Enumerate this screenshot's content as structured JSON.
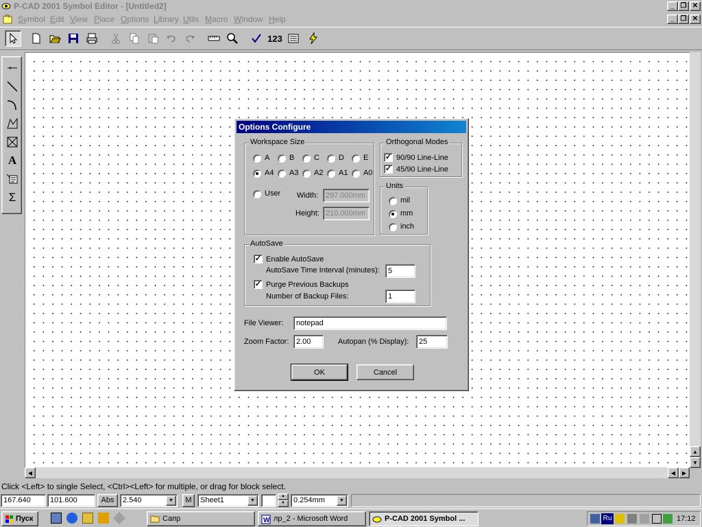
{
  "window": {
    "title": "P-CAD 2001 Symbol Editor - [Untitled2]",
    "controls": [
      "_",
      "❐",
      "✕"
    ]
  },
  "menu": [
    "Symbol",
    "Edit",
    "View",
    "Place",
    "Options",
    "Library",
    "Utils",
    "Macro",
    "Window",
    "Help"
  ],
  "toolbar": {
    "label_123": "123",
    "icons": [
      "select-arrow",
      "new-file",
      "open-folder",
      "save-disk",
      "print",
      "cut",
      "copy",
      "paste",
      "undo",
      "redo",
      "measure",
      "zoom",
      "check",
      "renumber",
      "properties",
      "lightning"
    ]
  },
  "left_tools": [
    "place-pin",
    "place-line",
    "place-arc",
    "place-polygon",
    "place-point",
    "place-text",
    "place-attribute",
    "place-field"
  ],
  "dialog": {
    "title": "Options Configure",
    "workspace_size": {
      "label": "Workspace Size",
      "row1": [
        "A",
        "B",
        "C",
        "D",
        "E"
      ],
      "row2": [
        "A4",
        "A3",
        "A2",
        "A1",
        "A0"
      ],
      "selected": "A4",
      "user_label": "User",
      "width_label": "Width:",
      "width_value": "297.000mm",
      "height_label": "Height:",
      "height_value": "210.000mm"
    },
    "orthogonal_modes": {
      "label": "Orthogonal Modes",
      "opt1": "90/90  Line-Line",
      "opt2": "45/90  Line-Line"
    },
    "units": {
      "label": "Units",
      "options": [
        "mil",
        "mm",
        "inch"
      ],
      "selected": "mm"
    },
    "autosave": {
      "label": "AutoSave",
      "enable_label": "Enable AutoSave",
      "interval_label": "AutoSave Time Interval (minutes):",
      "interval_value": "5",
      "purge_label": "Purge Previous Backups",
      "backups_label": "Number of Backup Files:",
      "backups_value": "1"
    },
    "file_viewer_label": "File Viewer:",
    "file_viewer_value": "notepad",
    "zoom_factor_label": "Zoom Factor:",
    "zoom_factor_value": "2.00",
    "autopan_label": "Autopan (% Display):",
    "autopan_value": "25",
    "ok_label": "OK",
    "cancel_label": "Cancel"
  },
  "status": {
    "message": "Click <Left> to single Select, <Ctrl><Left> for multiple, or drag for block select.",
    "x": "167.640",
    "y": "101.600",
    "abs": "Abs",
    "grid": "2.540",
    "m": "M",
    "sheet": "Sheet1",
    "line_width": "0.254mm"
  },
  "taskbar": {
    "start": "Пуск",
    "tasks": [
      "Сапр",
      "лр_2 - Microsoft Word",
      "P-CAD 2001 Symbol ..."
    ],
    "lang": "Ru",
    "clock": "17:12"
  }
}
